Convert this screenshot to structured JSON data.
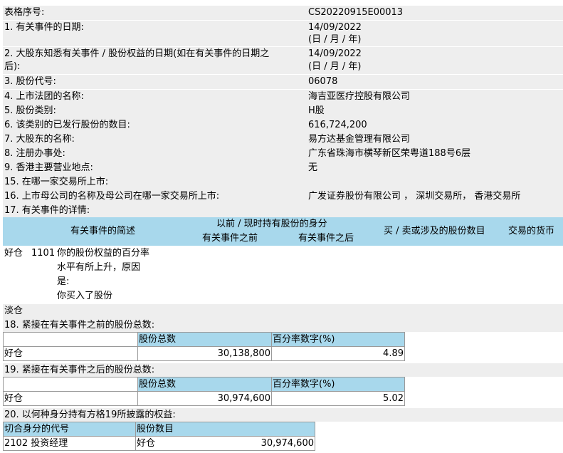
{
  "form": {
    "serial": {
      "label": "表格序号:",
      "value": "CS20220915E00013"
    },
    "q1": {
      "label": "1. 有关事件的日期:",
      "value": "14/09/2022",
      "note": "(日 / 月 / 年)"
    },
    "q2": {
      "label_line1": "2. 大股东知悉有关事件 / 股份权益的日期(如在有关事件的日期之",
      "label_line2": "后):",
      "value": "14/09/2022",
      "note": "(日 / 月 / 年)"
    },
    "q3": {
      "label": "3. 股份代号:",
      "value": "06078"
    },
    "q4": {
      "label": "4. 上市法团的名称:",
      "value": "海吉亚医疗控股有限公司"
    },
    "q5": {
      "label": "5. 股份类别:",
      "value": "H股"
    },
    "q6": {
      "label": "6. 该类别的已发行股份的数目:",
      "value": "616,724,200"
    },
    "q7": {
      "label": "7. 大股东的名称:",
      "value": "易方达基金管理有限公司"
    },
    "q8": {
      "label": "8. 注册办事处:",
      "value": "广东省珠海市横琴新区荣粤道188号6层"
    },
    "q9": {
      "label": "9. 香港主要营业地点:",
      "value": "无"
    },
    "q15": {
      "label": "15. 在哪一家交易所上市:",
      "value": ""
    },
    "q16": {
      "label": "16. 上市母公司的名称及母公司在哪一家交易所上市:",
      "value": "广发证券股份有限公司 ， 深圳交易所， 香港交易所"
    },
    "q17": {
      "label": "17. 有关事件的详情:"
    }
  },
  "event_header": {
    "description": "有关事件的简述",
    "capacity": "以前 / 现时持有股份的身分",
    "before": "有关事件之前",
    "after": "有关事件之后",
    "shares": "买 / 卖或涉及的股份数目",
    "currency": "交易的货币"
  },
  "event_row": {
    "position": "好仓",
    "code": "1101",
    "desc_line1": "你的股份权益的百分率",
    "desc_line2": "水平有所上升，原因",
    "desc_line3": "是:",
    "desc_line4": "你买入了股份"
  },
  "short_label": "淡仓",
  "q18": {
    "label": "18. 紧接在有关事件之前的股份总数:",
    "col_shares": "股份总数",
    "col_pct": "百分率数字(%)",
    "row_label": "好仓",
    "shares": "30,138,800",
    "pct": "4.89"
  },
  "q19": {
    "label": "19. 紧接在有关事件之后的股份总数:",
    "col_shares": "股份总数",
    "col_pct": "百分率数字(%)",
    "row_label": "好仓",
    "shares": "30,974,600",
    "pct": "5.02"
  },
  "q20": {
    "label": "20. 以何种身分持有方格19所披露的权益:",
    "col_code": "切合身分的代号",
    "col_shares": "股份数目",
    "code": "2102",
    "capacity": "投资经理",
    "position": "好仓",
    "shares": "30,974,600"
  },
  "colors": {
    "row_bg": "#eeeeee",
    "header_bg": "#a8d8ec",
    "border": "#9a9a9a"
  }
}
